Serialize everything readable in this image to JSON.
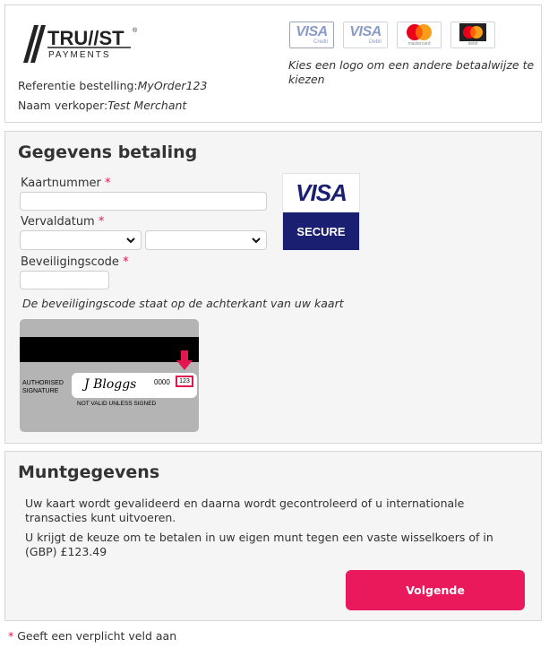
{
  "header": {
    "logo": {
      "line1": "TRU//ST",
      "line2": "PAYMENTS"
    },
    "reference_label": "Referentie bestelling:",
    "reference_value": "MyOrder123",
    "merchant_label": "Naam verkoper:",
    "merchant_value": "Test Merchant",
    "card_logos": [
      {
        "brand": "VISA",
        "sub": "Credit",
        "icon": "visa-credit-icon"
      },
      {
        "brand": "VISA",
        "sub": "Debit",
        "icon": "visa-debit-icon"
      },
      {
        "brand": "mastercard",
        "sub": "mastercard",
        "icon": "mastercard-icon"
      },
      {
        "brand": "mastercard debit",
        "sub": "debit",
        "icon": "mastercard-debit-icon"
      }
    ],
    "card_hint": "Kies een logo om een andere betaalwijze te kiezen"
  },
  "payment": {
    "title": "Gegevens betaling",
    "card_number_label": "Kaartnummer",
    "expiry_label": "Vervaldatum",
    "security_code_label": "Beveiligingscode",
    "required_marker": "*",
    "card_number_value": "",
    "month_value": "",
    "year_value": "",
    "security_code_value": "",
    "visa_secure": {
      "brand": "VISA",
      "label": "SECURE"
    },
    "cvv_hint": "De beveiligingscode staat op de achterkant van uw kaart",
    "card_back": {
      "auth_line1": "AUTHORISED",
      "auth_line2": "SIGNATURE",
      "signature": "J Bloggs",
      "number": "0000",
      "cvv": "123",
      "not_valid": "NOT VALID UNLESS SIGNED"
    }
  },
  "currency": {
    "title": "Muntgegevens",
    "text1": "Uw kaart wordt gevalideerd en daarna wordt gecontroleerd of u internationale transacties kunt uitvoeren.",
    "text2": "U krijgt de keuze om te betalen in uw eigen munt tegen een vaste wisselkoers of in (GBP) £123.49",
    "next_label": "Volgende"
  },
  "footer": {
    "required_marker": "*",
    "required_note": "Geeft een verplicht veld aan"
  },
  "colors": {
    "accent": "#e9195b",
    "visa_blue": "#1a1f71",
    "required": "#e3174f"
  }
}
